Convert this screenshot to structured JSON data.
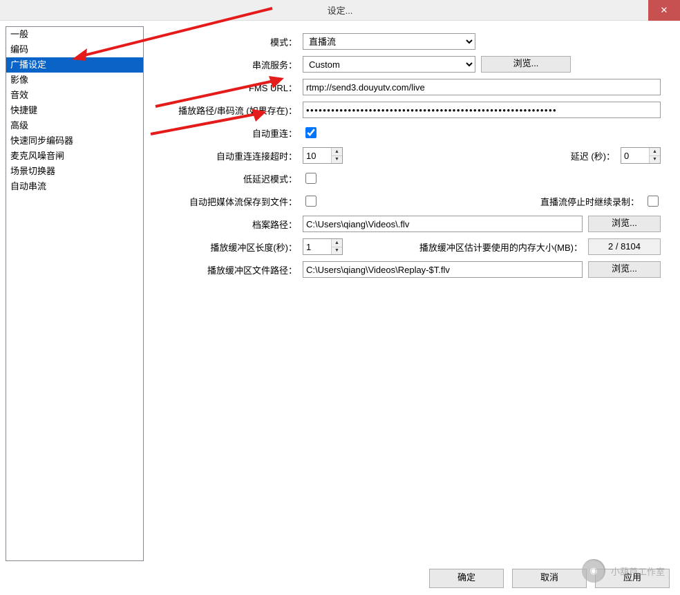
{
  "window": {
    "title": "设定..."
  },
  "sidebar": {
    "items": [
      {
        "label": "一般"
      },
      {
        "label": "编码"
      },
      {
        "label": "广播设定",
        "selected": true
      },
      {
        "label": "影像"
      },
      {
        "label": "音效"
      },
      {
        "label": "快捷键"
      },
      {
        "label": "高级"
      },
      {
        "label": "快速同步编码器"
      },
      {
        "label": "麦克风噪音闸"
      },
      {
        "label": "场景切换器"
      },
      {
        "label": "自动串流"
      }
    ]
  },
  "form": {
    "mode_label": "模式：",
    "mode_value": "直播流",
    "service_label": "串流服务：",
    "service_value": "Custom",
    "browse_label": "浏览...",
    "fms_label": "FMS URL：",
    "fms_value": "rtmp://send3.douyutv.com/live",
    "playpath_label": "播放路径/串码流 (如果存在)：",
    "playpath_value": "●●●●●●●●●●●●●●●●●●●●●●●●●●●●●●●●●●●●●●●●●●●●●●●●●●●●●●●●●●●●",
    "autoreconnect_label": "自动重连：",
    "autoreconnect_checked": true,
    "retry_label": "自动重连连接超时：",
    "retry_value": "10",
    "delay_label": "延迟 (秒)：",
    "delay_value": "0",
    "lowlatency_label": "低延迟模式：",
    "savefile_label": "自动把媒体流保存到文件：",
    "keeprec_label": "直播流停止时继续录制：",
    "filepath_label": "档案路径：",
    "filepath_value": "C:\\Users\\qiang\\Videos\\.flv",
    "buflen_label": "播放缓冲区长度(秒)：",
    "buflen_value": "1",
    "mem_label": "播放缓冲区估计要使用的内存大小(MB)：",
    "mem_value": "2 / 8104",
    "replay_label": "播放缓冲区文件路径：",
    "replay_value": "C:\\Users\\qiang\\Videos\\Replay-$T.flv"
  },
  "footer": {
    "ok": "确定",
    "cancel": "取消",
    "apply": "应用"
  },
  "watermark": {
    "text": "小葫芦工作室"
  }
}
